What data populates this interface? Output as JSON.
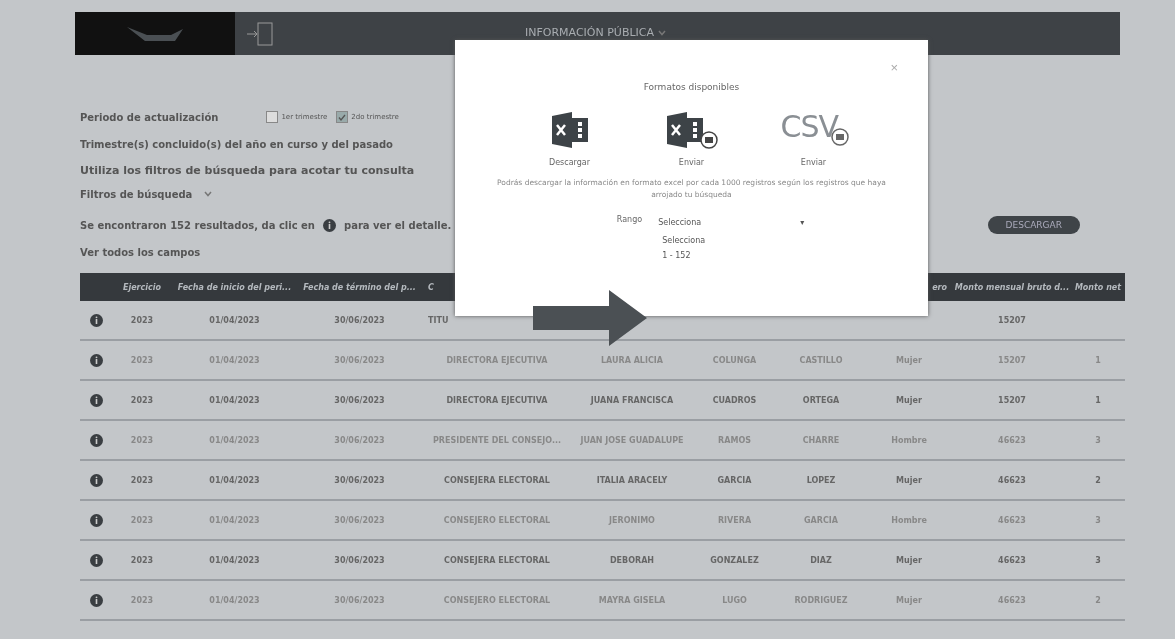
{
  "header": {
    "title": "INFORMACIÓN PÚBLICA"
  },
  "period": {
    "label": "Periodo de actualización",
    "options": [
      {
        "label": "1er trimestre",
        "checked": false
      },
      {
        "label": "2do trimestre",
        "checked": true
      }
    ]
  },
  "texts": {
    "quarters": "Trimestre(s) concluido(s) del año en curso y del pasado",
    "hint": "Utiliza los filtros de búsqueda para acotar tu consulta",
    "filters": "Filtros de búsqueda",
    "results_before": "Se encontraron 152 resultados, da clic en",
    "results_after": "para ver el detalle.",
    "all_fields": "Ver todos los campos"
  },
  "download_button": "DESCARGAR",
  "table": {
    "columns": [
      "Ejercicio",
      "Fecha de inicio del peri...",
      "Fecha de término del p...",
      "C",
      null,
      null,
      null,
      "ero",
      "Monto mensual bruto d...",
      "Monto net"
    ],
    "rows": [
      [
        "2023",
        "01/04/2023",
        "30/06/2023",
        "TITU",
        null,
        null,
        null,
        null,
        "15207",
        null
      ],
      [
        "2023",
        "01/04/2023",
        "30/06/2023",
        "DIRECTORA EJECUTIVA",
        "LAURA ALICIA",
        "COLUNGA",
        "CASTILLO",
        "Mujer",
        "15207",
        "1"
      ],
      [
        "2023",
        "01/04/2023",
        "30/06/2023",
        "DIRECTORA EJECUTIVA",
        "JUANA FRANCISCA",
        "CUADROS",
        "ORTEGA",
        "Mujer",
        "15207",
        "1"
      ],
      [
        "2023",
        "01/04/2023",
        "30/06/2023",
        "PRESIDENTE DEL CONSEJO...",
        "JUAN JOSE GUADALUPE",
        "RAMOS",
        "CHARRE",
        "Hombre",
        "46623",
        "3"
      ],
      [
        "2023",
        "01/04/2023",
        "30/06/2023",
        "CONSEJERA ELECTORAL",
        "ITALIA ARACELY",
        "GARCIA",
        "LOPEZ",
        "Mujer",
        "46623",
        "2"
      ],
      [
        "2023",
        "01/04/2023",
        "30/06/2023",
        "CONSEJERO ELECTORAL",
        "JERONIMO",
        "RIVERA",
        "GARCIA",
        "Hombre",
        "46623",
        "3"
      ],
      [
        "2023",
        "01/04/2023",
        "30/06/2023",
        "CONSEJERA ELECTORAL",
        "DEBORAH",
        "GONZALEZ",
        "DIAZ",
        "Mujer",
        "46623",
        "3"
      ],
      [
        "2023",
        "01/04/2023",
        "30/06/2023",
        "CONSEJERO ELECTORAL",
        "MAYRA GISELA",
        "LUGO",
        "RODRIGUEZ",
        "Mujer",
        "46623",
        "2"
      ]
    ]
  },
  "modal": {
    "close": "×",
    "title": "Formatos disponibles",
    "formats": [
      {
        "kind": "excel",
        "label": "Descargar"
      },
      {
        "kind": "excel_mail",
        "label": "Enviar"
      },
      {
        "kind": "csv_mail",
        "icon_text": "CSV",
        "label": "Enviar"
      }
    ],
    "note": "Podrás descargar la información en formato excel por cada 1000 registros según los registros que haya arrojado tu búsqueda",
    "range_label": "Rango",
    "select": {
      "value": "Selecciona",
      "caret": "▾"
    },
    "options": [
      {
        "label": "Selecciona",
        "selected": false
      },
      {
        "label": "1 - 152",
        "selected": false
      }
    ]
  }
}
